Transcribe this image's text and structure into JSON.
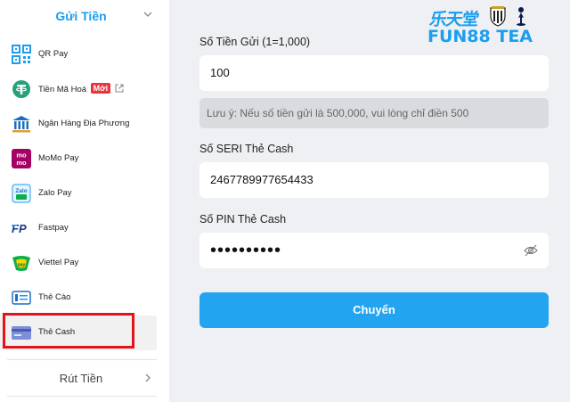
{
  "sidebar": {
    "deposit_title": "Gửi Tiền",
    "withdraw_title": "Rút Tiền",
    "items": [
      {
        "label": "QR Pay",
        "icon": "qr-code-icon"
      },
      {
        "label": "Tiền Mã Hoá",
        "icon": "tether-icon",
        "badge": "Mới",
        "trailing_icon": "external-link-icon"
      },
      {
        "label": "Ngân Hàng Địa Phương",
        "icon": "bank-icon"
      },
      {
        "label": "MoMo Pay",
        "icon": "momo-icon"
      },
      {
        "label": "Zalo Pay",
        "icon": "zalopay-icon"
      },
      {
        "label": "Fastpay",
        "icon": "fastpay-icon"
      },
      {
        "label": "Viettel Pay",
        "icon": "viettelpay-icon"
      },
      {
        "label": "Thẻ Cào",
        "icon": "scratch-card-icon"
      },
      {
        "label": "Thẻ Cash",
        "icon": "cash-card-icon",
        "active": true
      }
    ]
  },
  "logo": {
    "cn_text": "乐天堂",
    "brand_text": "FUN88 TEA"
  },
  "form": {
    "amount_label": "Số Tiền Gửi (1=1,000)",
    "amount_value": "100",
    "note": "Lưu ý: Nếu số tiền gửi là 500,000, vui lòng chỉ điền 500",
    "serial_label": "Số SERI Thẻ Cash",
    "serial_value": "2467789977654433",
    "pin_label": "Số PIN Thẻ Cash",
    "pin_value": "••••••••••",
    "submit_label": "Chuyển"
  },
  "colors": {
    "accent": "#1b9df0",
    "button": "#22a4f1",
    "highlight_border": "#e0141a",
    "new_badge": "#e8343b",
    "panel_bg": "#eef0f3"
  }
}
